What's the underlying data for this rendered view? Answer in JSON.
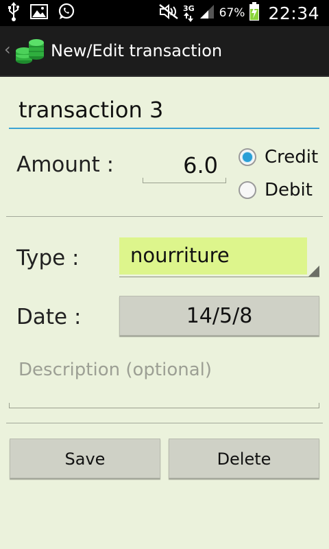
{
  "status_bar": {
    "icons_left": [
      "usb-icon",
      "image-icon",
      "whatsapp-icon"
    ],
    "icons_right": [
      "mute-icon",
      "network-3g-icon",
      "signal-icon",
      "battery-charging-icon"
    ],
    "network_label": "3G",
    "battery_percent": "67%",
    "time": "22:34"
  },
  "action_bar": {
    "title": "New/Edit transaction",
    "icon": "coins-icon"
  },
  "form": {
    "name_value": "transaction 3",
    "amount_label": "Amount :",
    "amount_value": "6.0",
    "radio_credit": "Credit",
    "radio_debit": "Debit",
    "selected_radio": "Credit",
    "type_label": "Type :",
    "type_value": "nourriture",
    "date_label": "Date :",
    "date_value": "14/5/8",
    "description_placeholder": "Description (optional)",
    "description_value": ""
  },
  "buttons": {
    "save_label": "Save",
    "delete_label": "Delete"
  },
  "colors": {
    "background": "#ebf2dc",
    "accent": "#2a9fd6",
    "spinner_highlight": "#ddf58c",
    "coin_green": "#2fae3e"
  }
}
